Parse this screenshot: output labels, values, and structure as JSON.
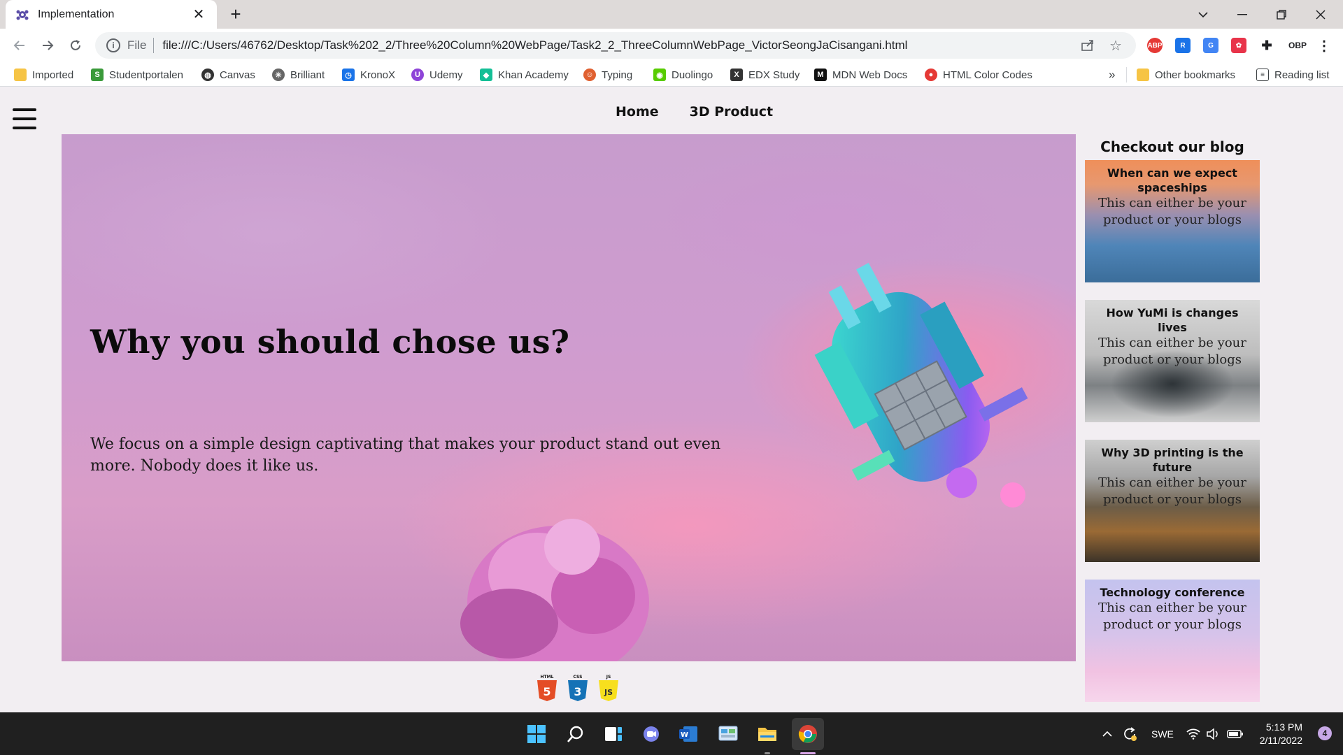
{
  "browser": {
    "tab_title": "Implementation",
    "new_tab": "+",
    "address_scheme": "File",
    "address_url": "file:///C:/Users/46762/Desktop/Task%202_2/Three%20Column%20WebPage/Task2_2_ThreeColumnWebPage_VictorSeongJaCisangani.html",
    "bookmarks": [
      {
        "label": "Imported",
        "icon": "folder-icon",
        "color": "#f6c445"
      },
      {
        "label": "Studentportalen",
        "icon": "studentportalen-icon",
        "color": "#3a9a3a"
      },
      {
        "label": "Canvas",
        "icon": "globe-icon",
        "color": "#333333"
      },
      {
        "label": "Brilliant",
        "icon": "brilliant-icon",
        "color": "#555555"
      },
      {
        "label": "KronoX",
        "icon": "kronox-icon",
        "color": "#1a73e8"
      },
      {
        "label": "Udemy",
        "icon": "udemy-icon",
        "color": "#8e44d8"
      },
      {
        "label": "Khan Academy",
        "icon": "khan-icon",
        "color": "#14bf96"
      },
      {
        "label": "Typing",
        "icon": "typing-icon",
        "color": "#e06030"
      },
      {
        "label": "Duolingo",
        "icon": "duolingo-icon",
        "color": "#58cc02"
      },
      {
        "label": "EDX Study",
        "icon": "edx-icon",
        "color": "#333333"
      },
      {
        "label": "MDN Web Docs",
        "icon": "mdn-icon",
        "color": "#111111"
      },
      {
        "label": "HTML Color Codes",
        "icon": "color-icon",
        "color": "#e53935"
      }
    ],
    "bookmarks_more": "»",
    "other_bookmarks": "Other bookmarks",
    "reading_list": "Reading list"
  },
  "page": {
    "nav": [
      {
        "label": "Home"
      },
      {
        "label": "3D Product"
      }
    ],
    "hero": {
      "title": "Why you should chose us?",
      "text": "We focus on a simple design captivating that makes your product stand out even more. Nobody does it like us."
    },
    "tech_icons": [
      {
        "label": "HTML",
        "digit": "5",
        "color": "#e44d26"
      },
      {
        "label": "CSS",
        "digit": "3",
        "color": "#1572b6"
      },
      {
        "label": "JS",
        "digit": "JS",
        "color": "#f7df1e"
      }
    ],
    "sidebar": {
      "title": "Checkout our blog",
      "cards": [
        {
          "title": "When can we expect spaceships",
          "text": "This can either be your product or your blogs"
        },
        {
          "title": "How YuMi is changes lives",
          "text": "This can either be your product or your blogs"
        },
        {
          "title": "Why 3D printing is the future",
          "text": "This can either be your product or your blogs"
        },
        {
          "title": "Technology conference",
          "text": "This can either be your product or your blogs"
        }
      ]
    }
  },
  "taskbar": {
    "language": "SWE",
    "time": "5:13 PM",
    "date": "2/11/2022",
    "notifications": "4"
  }
}
